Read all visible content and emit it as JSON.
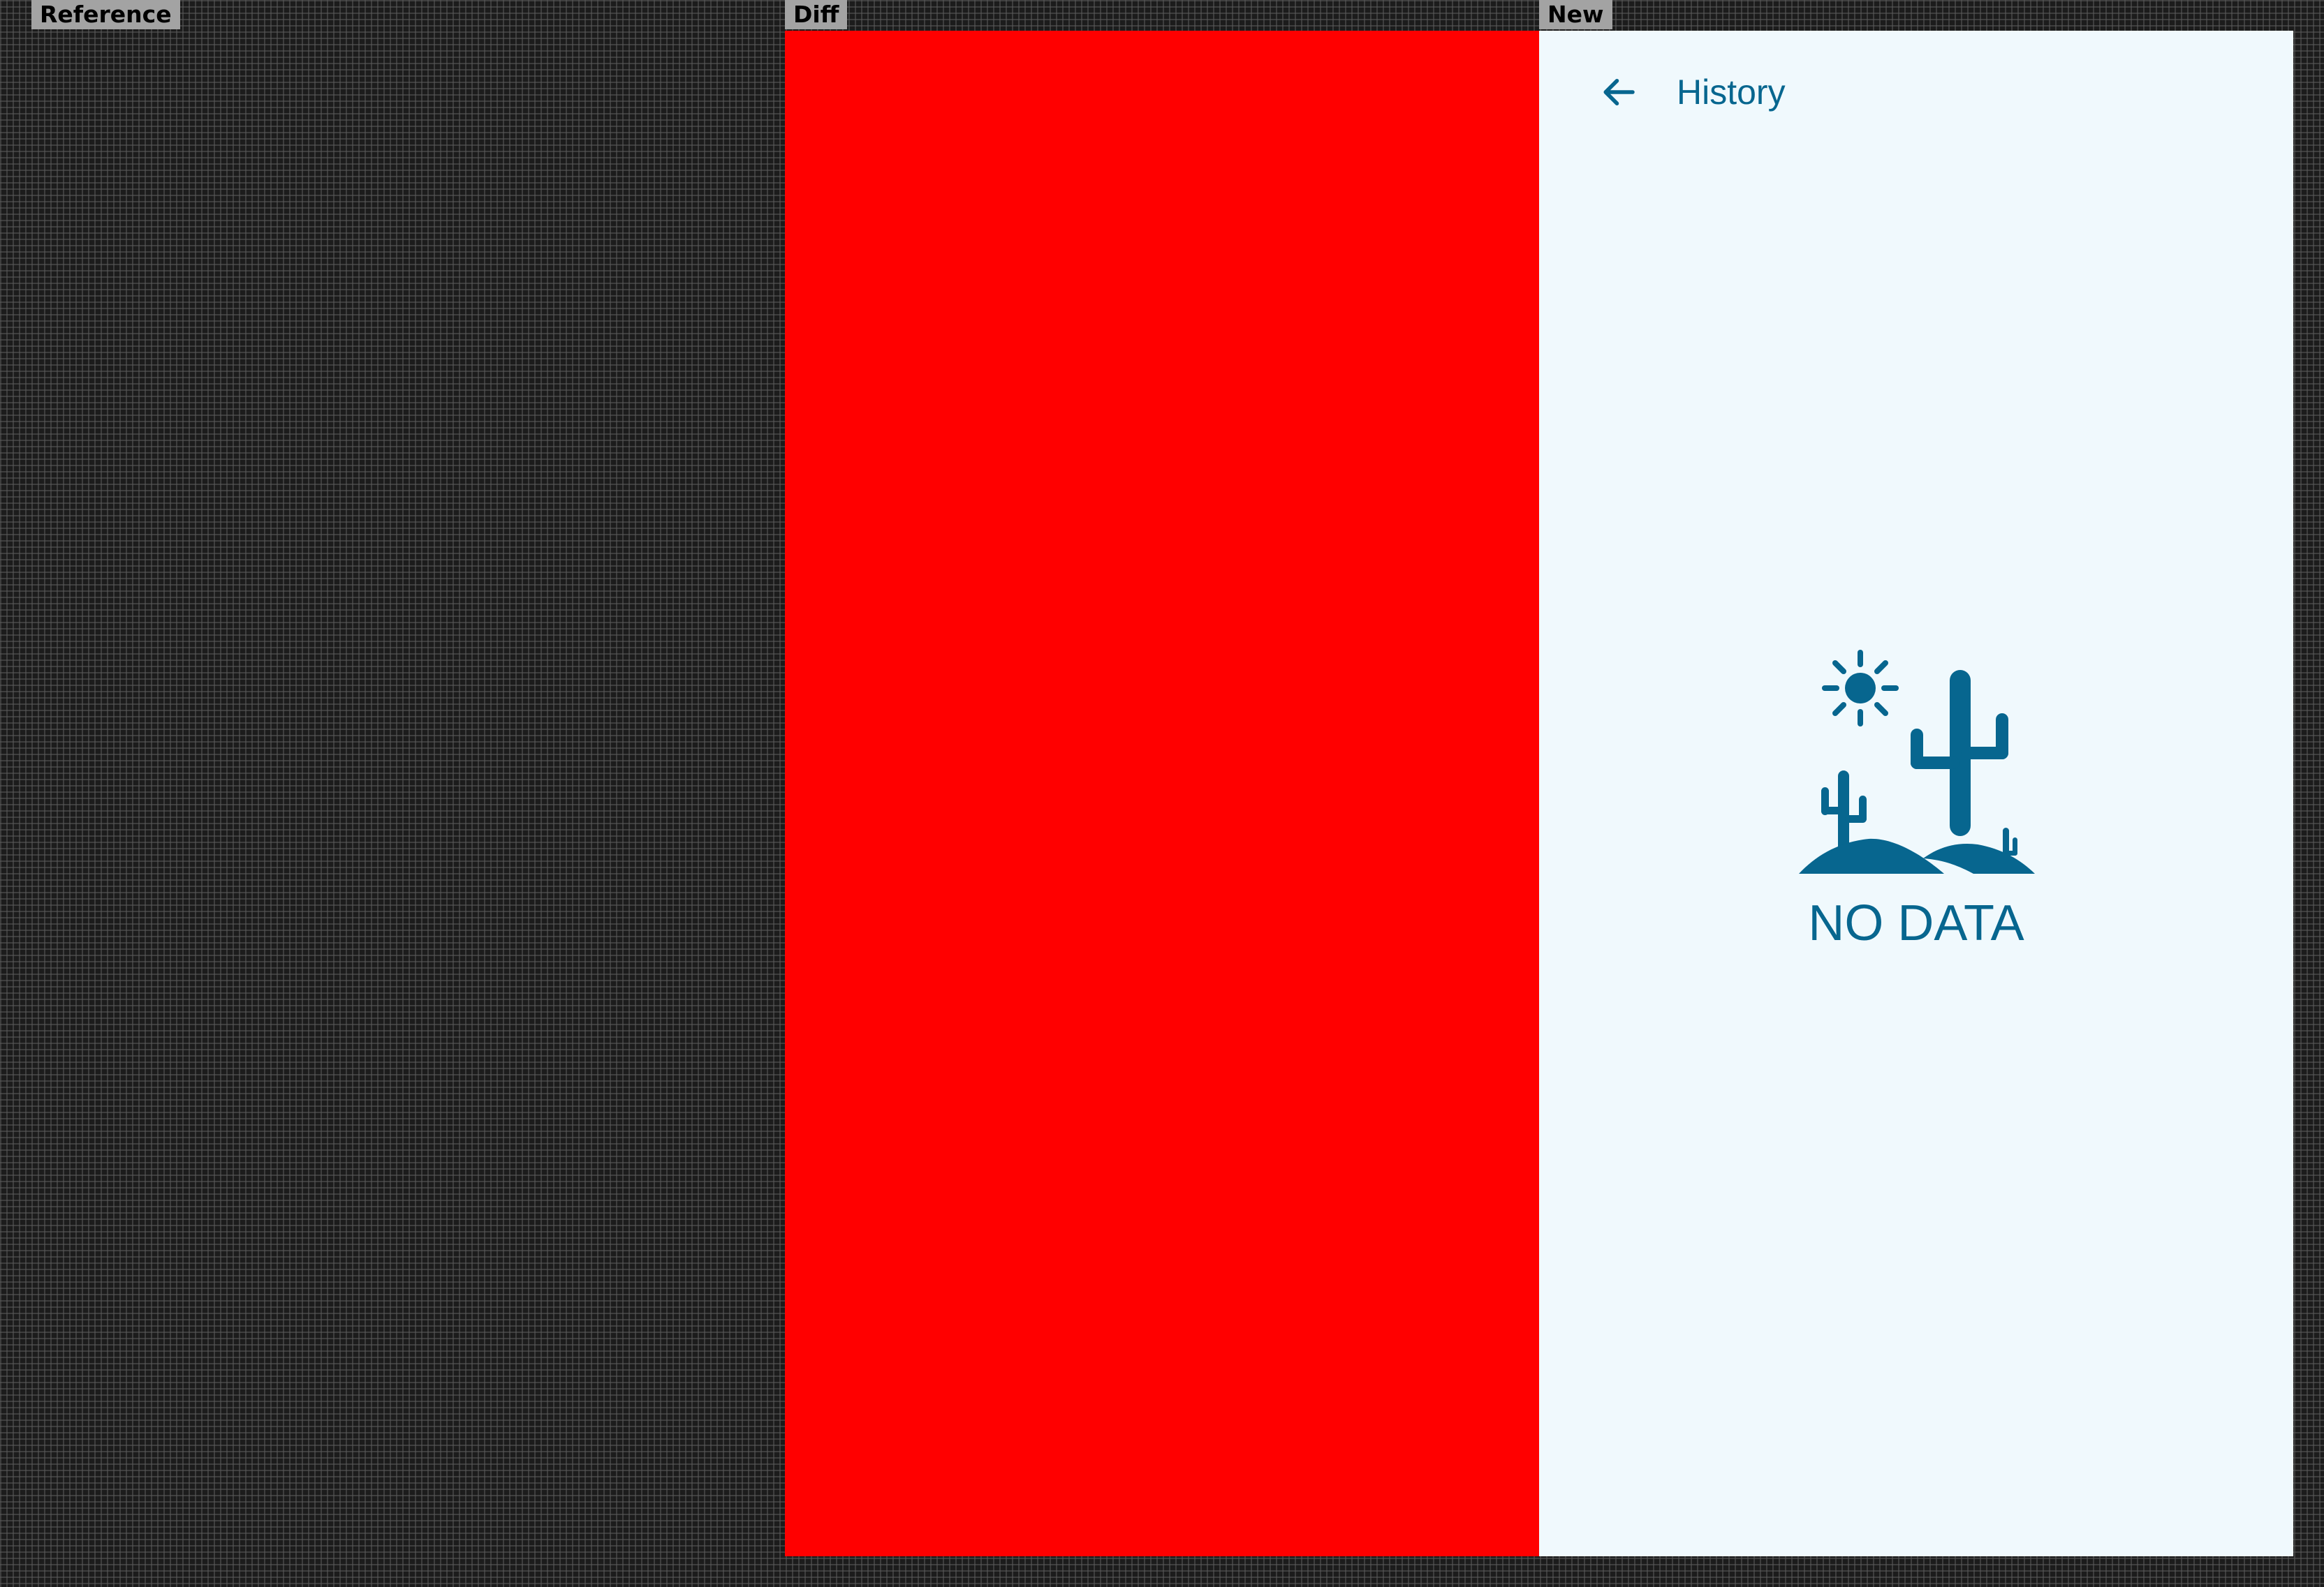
{
  "panels": {
    "reference_label": "Reference",
    "diff_label": "Diff",
    "new_label": "New"
  },
  "colors": {
    "diff_fill": "#ff0000",
    "screen_background": "#f0f9fd",
    "accent": "#07668f"
  },
  "app_bar": {
    "back_icon": "arrow-left-icon",
    "title": "History"
  },
  "empty_state": {
    "illustration": "desert-cactus-icon",
    "message": "NO DATA"
  }
}
